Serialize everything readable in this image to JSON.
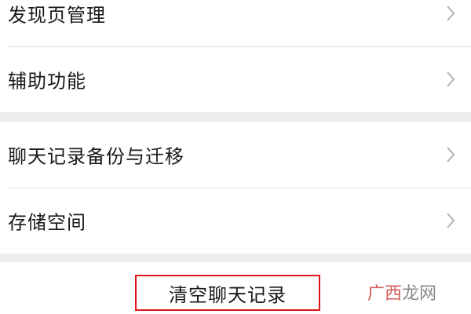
{
  "settings_list": {
    "group1": [
      {
        "label": "发现页管理"
      },
      {
        "label": "辅助功能"
      }
    ],
    "group2": [
      {
        "label": "聊天记录备份与迁移"
      },
      {
        "label": "存储空间"
      }
    ]
  },
  "clear_chat_button": {
    "label": "清空聊天记录",
    "highlight_color": "#e0141b"
  },
  "watermark": {
    "part1": "广西",
    "part2": "龙网"
  },
  "icons": {
    "row_chevron": "chevron-right-icon"
  },
  "colors": {
    "section_gap": "#ededed",
    "divider": "#e3e3e3",
    "chevron": "#b2b2b2",
    "text": "#1a1a1a"
  }
}
